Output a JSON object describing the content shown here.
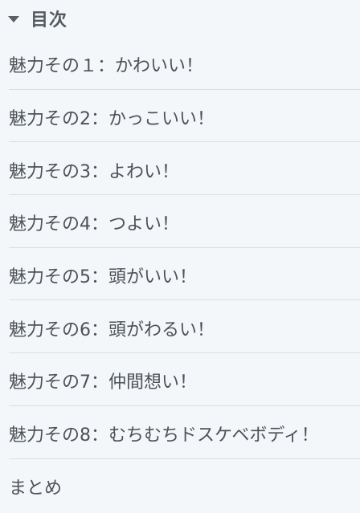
{
  "toc": {
    "title": "目次",
    "items": [
      "魅力その１：かわいい！",
      "魅力その2：かっこいい！",
      "魅力その3：よわい！",
      "魅力その4：つよい！",
      "魅力その5：頭がいい！",
      "魅力その6：頭がわるい！",
      "魅力その7：仲間想い！",
      "魅力その8：むちむちドスケベボディ！",
      "まとめ"
    ]
  }
}
